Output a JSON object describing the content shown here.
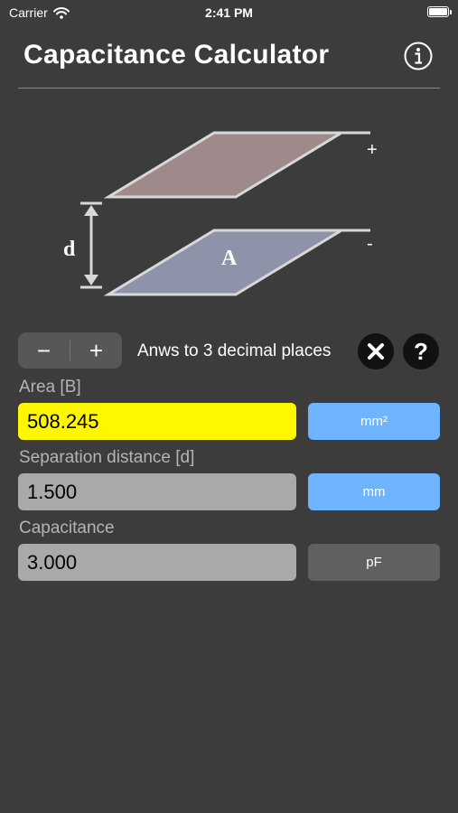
{
  "status": {
    "carrier": "Carrier",
    "time": "2:41 PM"
  },
  "header": {
    "title": "Capacitance Calculator"
  },
  "diagram": {
    "label_plus": "+",
    "label_minus": "-",
    "label_d": "d",
    "label_A": "A"
  },
  "precision": {
    "minus_label": "−",
    "plus_label": "+",
    "label": "Anws to 3 decimal places",
    "clear_label": "✕",
    "help_label": "?"
  },
  "fields": {
    "area": {
      "label": "Area [B]",
      "value": "508.245",
      "unit": "mm²"
    },
    "separation": {
      "label": "Separation distance [d]",
      "value": "1.500",
      "unit": "mm"
    },
    "capacitance": {
      "label": "Capacitance",
      "value": "3.000",
      "unit": "pF"
    }
  }
}
